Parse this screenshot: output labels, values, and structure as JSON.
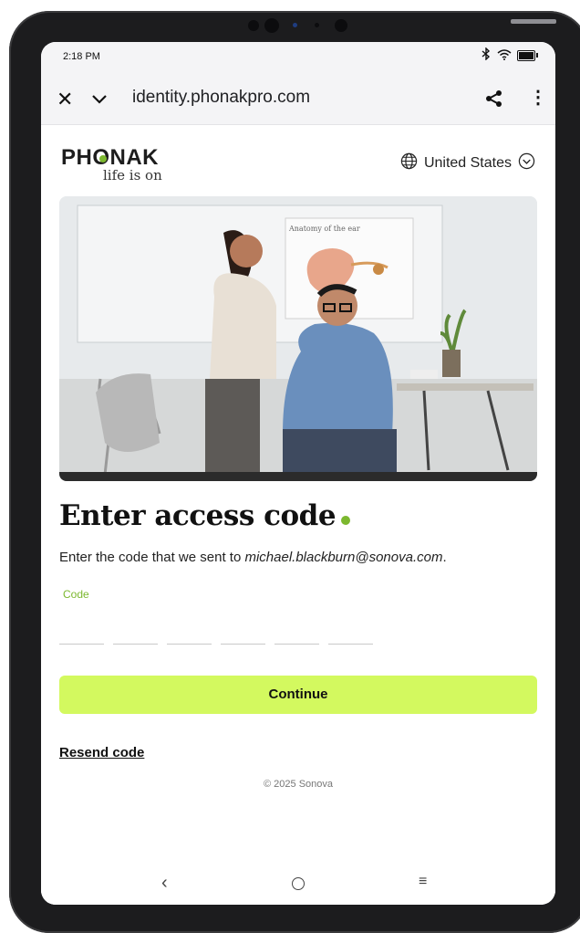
{
  "status": {
    "time": "2:18 PM"
  },
  "browser": {
    "url": "identity.phonakpro.com"
  },
  "header": {
    "brand": "PHONAK",
    "tagline": "life is on",
    "region": "United States"
  },
  "hero": {
    "poster_title": "Anatomy of the ear"
  },
  "main": {
    "title": "Enter access code",
    "instruction_prefix": "Enter the code that we sent to ",
    "email": "michael.blackburn@sonova.com",
    "instruction_suffix": ".",
    "code_label": "Code",
    "code_fields": [
      "",
      "",
      "",
      "",
      "",
      ""
    ],
    "continue_label": "Continue",
    "resend_label": "Resend code",
    "copyright": "© 2025 Sonova"
  },
  "colors": {
    "accent_green": "#7cb82f",
    "button_lime": "#d3f95f"
  }
}
